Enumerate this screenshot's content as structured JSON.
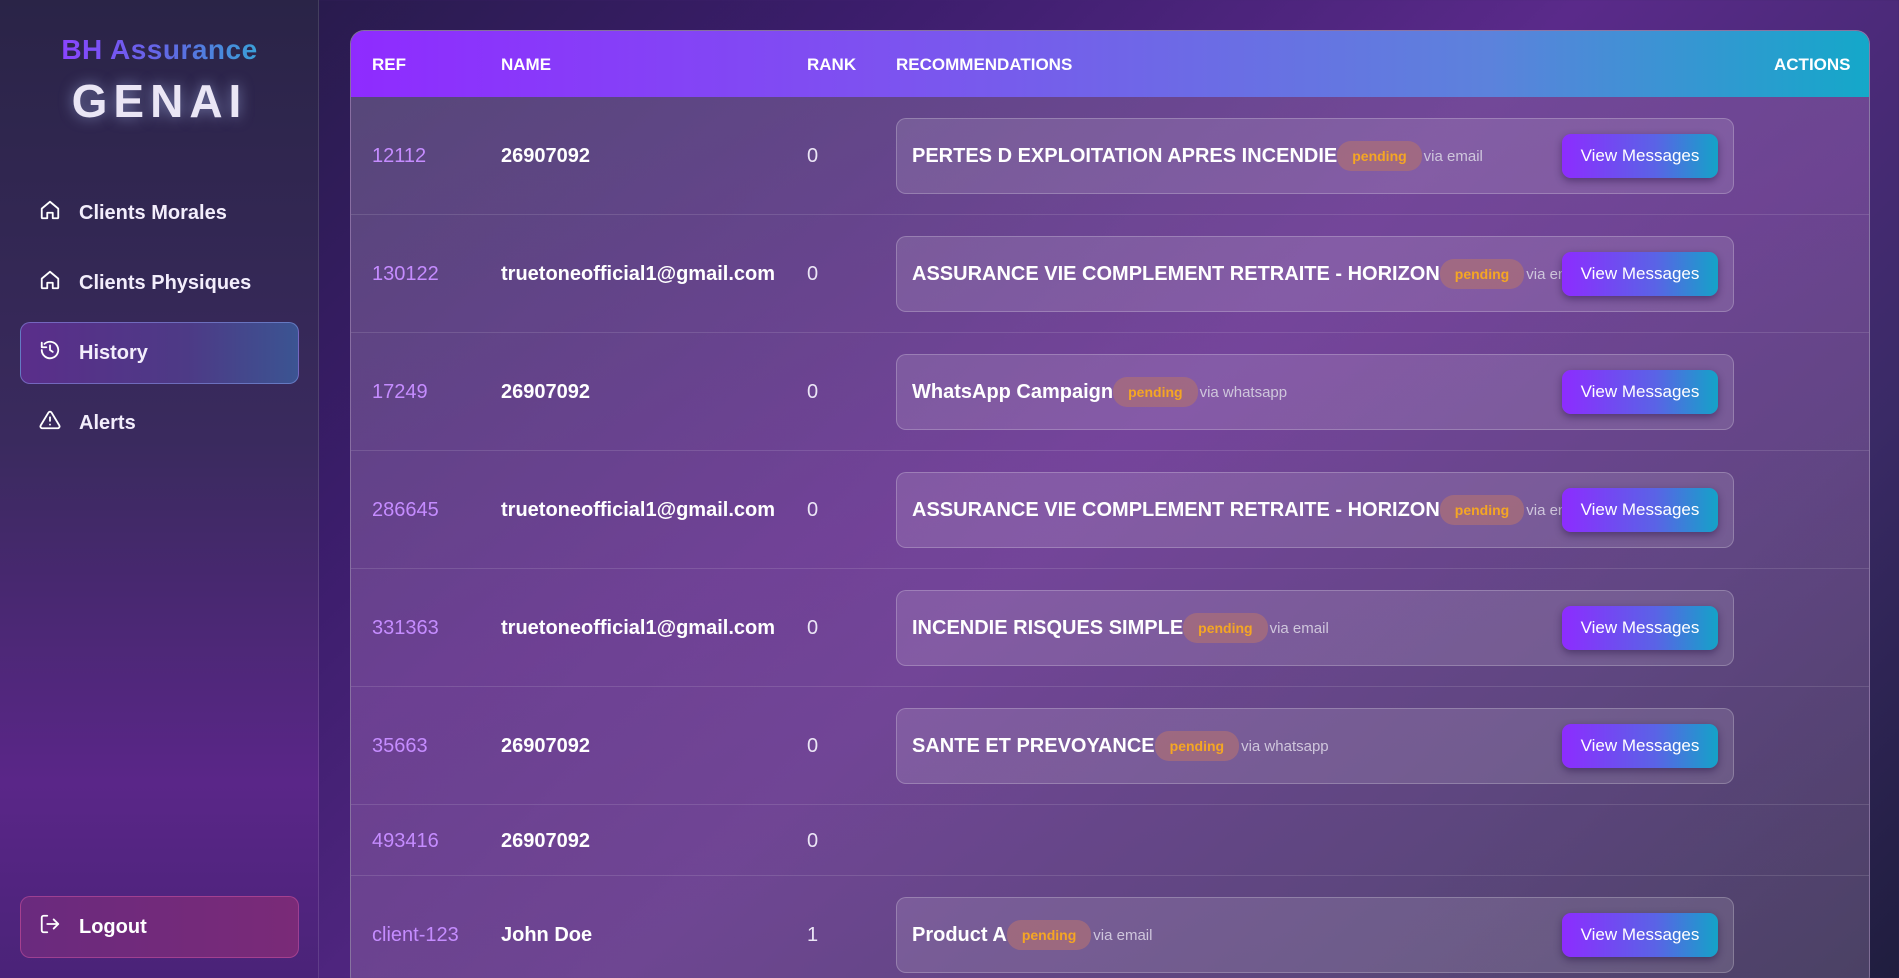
{
  "brand": {
    "top": "BH Assurance",
    "main": "GENAI"
  },
  "nav": [
    {
      "label": "Clients Morales",
      "icon": "home-icon",
      "active": false
    },
    {
      "label": "Clients Physiques",
      "icon": "home-icon",
      "active": false
    },
    {
      "label": "History",
      "icon": "history-icon",
      "active": true
    },
    {
      "label": "Alerts",
      "icon": "alert-triangle-icon",
      "active": false
    }
  ],
  "logout": {
    "label": "Logout",
    "icon": "logout-icon"
  },
  "table": {
    "headers": {
      "ref": "REF",
      "name": "NAME",
      "rank": "RANK",
      "recommendations": "RECOMMENDATIONS",
      "actions": "ACTIONS"
    },
    "action_label": "View Messages",
    "rows": [
      {
        "ref": "12112",
        "name": "26907092",
        "rank": "0",
        "rec": {
          "title": "PERTES D EXPLOITATION APRES INCENDIE",
          "status": "pending",
          "channel": "via email"
        }
      },
      {
        "ref": "130122",
        "name": "truetoneofficial1@gmail.com",
        "rank": "0",
        "rec": {
          "title": "ASSURANCE VIE COMPLEMENT RETRAITE - HORIZON",
          "status": "pending",
          "channel": "via email"
        }
      },
      {
        "ref": "17249",
        "name": "26907092",
        "rank": "0",
        "rec": {
          "title": "WhatsApp Campaign",
          "status": "pending",
          "channel": "via whatsapp"
        }
      },
      {
        "ref": "286645",
        "name": "truetoneofficial1@gmail.com",
        "rank": "0",
        "rec": {
          "title": "ASSURANCE VIE COMPLEMENT RETRAITE - HORIZON",
          "status": "pending",
          "channel": "via email"
        }
      },
      {
        "ref": "331363",
        "name": "truetoneofficial1@gmail.com",
        "rank": "0",
        "rec": {
          "title": "INCENDIE RISQUES SIMPLE",
          "status": "pending",
          "channel": "via email"
        }
      },
      {
        "ref": "35663",
        "name": "26907092",
        "rank": "0",
        "rec": {
          "title": "SANTE ET PREVOYANCE",
          "status": "pending",
          "channel": "via whatsapp"
        }
      },
      {
        "ref": "493416",
        "name": "26907092",
        "rank": "0",
        "rec": null
      },
      {
        "ref": "client-123",
        "name": "John Doe",
        "rank": "1",
        "rec": {
          "title": "Product A",
          "status": "pending",
          "channel": "via email"
        }
      }
    ]
  }
}
